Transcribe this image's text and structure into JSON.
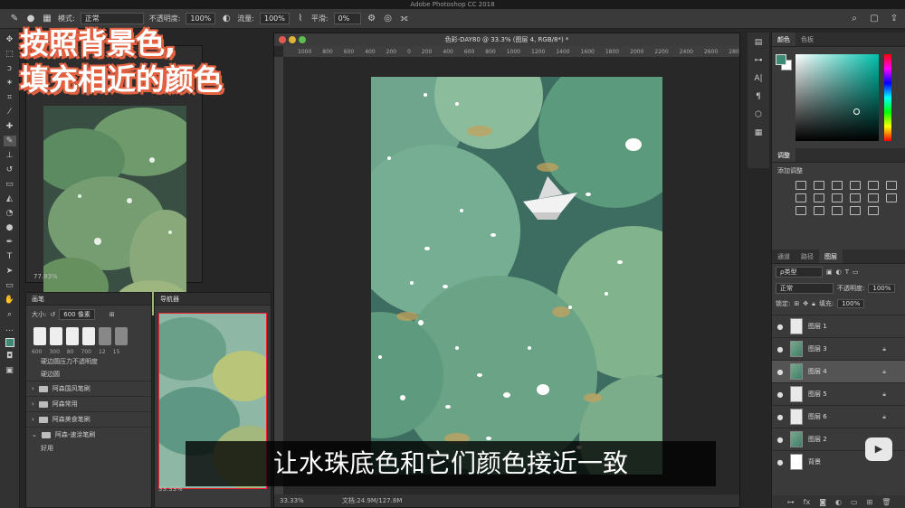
{
  "app": {
    "title": "Adobe Photoshop CC 2018"
  },
  "options_bar": {
    "mode_label": "模式:",
    "mode_value": "正常",
    "opacity_label": "不透明度:",
    "opacity_value": "100%",
    "flow_label": "流量:",
    "flow_value": "100%",
    "smoothing_label": "平滑:",
    "smoothing_value": "0%"
  },
  "overlay": {
    "line1": "按照背景色,",
    "line2": "填充相近的颜色"
  },
  "reference": {
    "zoom": "77.83%"
  },
  "brush_panel": {
    "tab": "画笔",
    "size_label": "大小:",
    "size_value": "600 像素",
    "preset_sizes": [
      "600",
      "300",
      "80",
      "700",
      "12",
      "15"
    ],
    "entries": [
      "硬边圆压力不透明度",
      "硬边圆"
    ],
    "groups": [
      "阿森国风笔刷",
      "阿森常用",
      "阿森美食笔刷",
      "阿森-速涂笔刷"
    ],
    "last_entry": "好用"
  },
  "navigator": {
    "tab": "导航器",
    "zoom": "33.33%"
  },
  "document": {
    "title": "色彩-DAY80 @ 33.3% (图层 4, RGB/8*) *",
    "ruler": [
      "1000",
      "800",
      "600",
      "400",
      "200",
      "0",
      "200",
      "400",
      "600",
      "800",
      "1000",
      "1200",
      "1400",
      "1600",
      "1800",
      "2000",
      "2200",
      "2400",
      "2600",
      "2800",
      "3000",
      "3200",
      "3400",
      "3600",
      "3800",
      "4000"
    ],
    "zoom": "33.33%",
    "doc_size": "文档:24.9M/127.8M"
  },
  "color_panel": {
    "tabs": [
      "颜色",
      "色板"
    ],
    "fg": "#3f8a75",
    "bg": "#ffffff"
  },
  "adjustments": {
    "tab": "调整",
    "title": "添加调整"
  },
  "layers_panel": {
    "tabs": [
      "通道",
      "路径",
      "图层"
    ],
    "kind": "ρ类型",
    "blend": "正常",
    "opacity_label": "不透明度:",
    "opacity": "100%",
    "lock_label": "锁定:",
    "fill_label": "填充:",
    "fill": "100%",
    "layers": [
      {
        "name": "图层 1",
        "thumb": "check",
        "locked": false,
        "selected": false
      },
      {
        "name": "图层 3",
        "thumb": "green",
        "locked": true,
        "selected": false
      },
      {
        "name": "图层 4",
        "thumb": "green",
        "locked": true,
        "selected": true
      },
      {
        "name": "图层 5",
        "thumb": "check",
        "locked": true,
        "selected": false
      },
      {
        "name": "图层 6",
        "thumb": "check",
        "locked": true,
        "selected": false
      },
      {
        "name": "图层 2",
        "thumb": "green",
        "locked": true,
        "selected": false
      },
      {
        "name": "背景",
        "thumb": "white",
        "locked": false,
        "selected": false
      }
    ]
  },
  "subtitle": "让水珠底色和它们颜色接近一致"
}
